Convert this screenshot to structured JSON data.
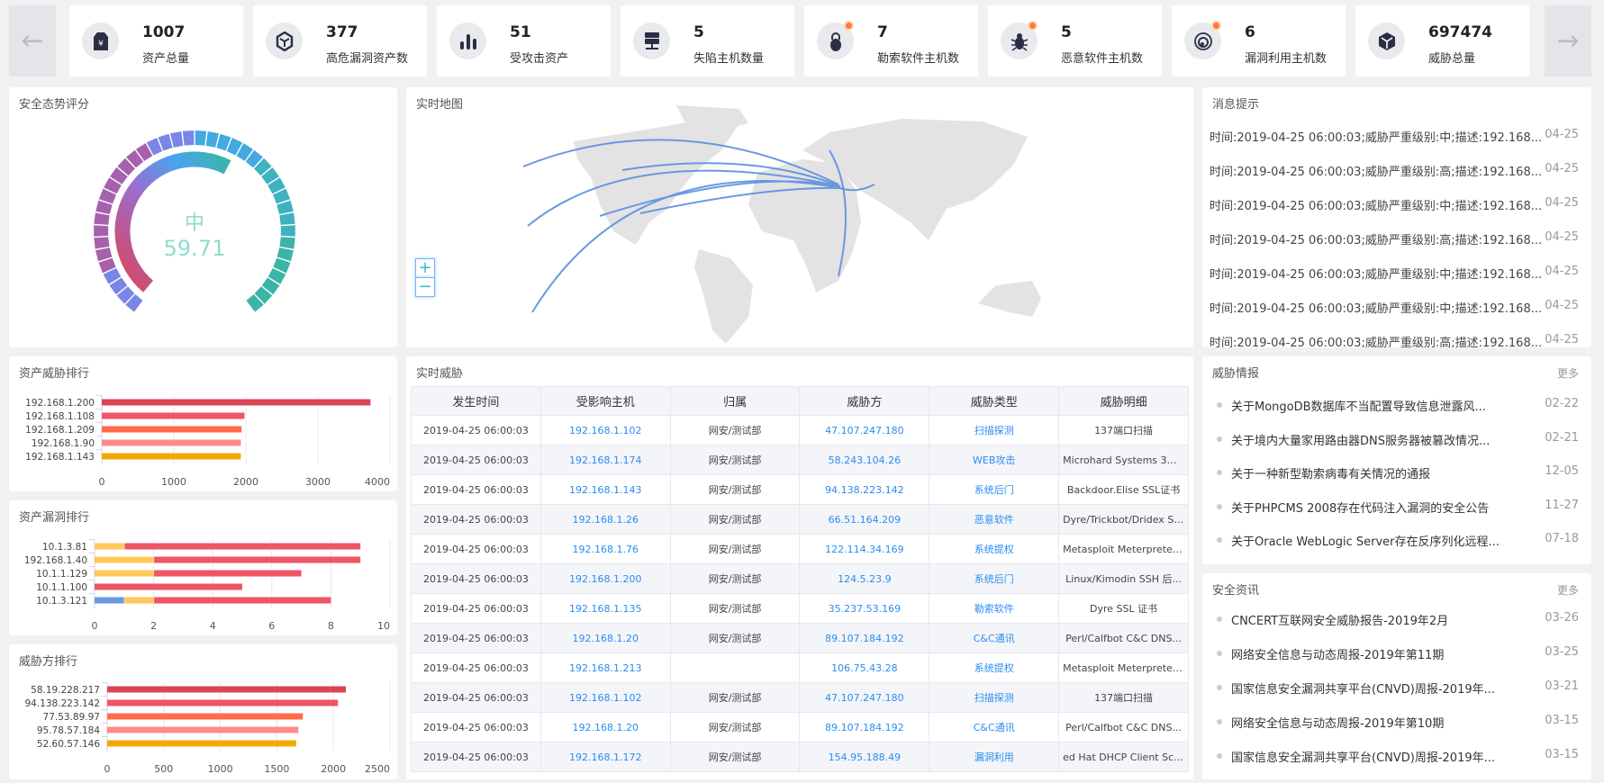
{
  "nav": {
    "prev_icon": "arrow-left-icon",
    "next_icon": "arrow-right-icon"
  },
  "stats": [
    {
      "value": "1007",
      "label": "资产总量",
      "icon": "money-tag-icon",
      "badge": false
    },
    {
      "value": "377",
      "label": "高危漏洞资产数",
      "icon": "shield-box-icon",
      "badge": false
    },
    {
      "value": "51",
      "label": "受攻击资产",
      "icon": "bar-chart-icon",
      "badge": false
    },
    {
      "value": "5",
      "label": "失陷主机数量",
      "icon": "server-icon",
      "badge": false
    },
    {
      "value": "7",
      "label": "勒索软件主机数",
      "icon": "lock-icon",
      "badge": true
    },
    {
      "value": "5",
      "label": "恶意软件主机数",
      "icon": "bug-icon",
      "badge": true
    },
    {
      "value": "6",
      "label": "漏洞利用主机数",
      "icon": "target-icon",
      "badge": true
    },
    {
      "value": "697474",
      "label": "威胁总量",
      "icon": "cube-icon",
      "badge": false
    }
  ],
  "gauge": {
    "title": "安全态势评分",
    "level": "中",
    "score": "59.71",
    "value": 59.71,
    "max": 100
  },
  "map": {
    "title": "实时地图",
    "zoom_in": "+",
    "zoom_out": "−"
  },
  "messages": {
    "title": "消息提示",
    "items": [
      {
        "text": "时间:2019-04-25 06:00:03;威胁严重级别:中;描述:192.168...",
        "date": "04-25"
      },
      {
        "text": "时间:2019-04-25 06:00:03;威胁严重级别:高;描述:192.168...",
        "date": "04-25"
      },
      {
        "text": "时间:2019-04-25 06:00:03;威胁严重级别:中;描述:192.168...",
        "date": "04-25"
      },
      {
        "text": "时间:2019-04-25 06:00:03;威胁严重级别:高;描述:192.168...",
        "date": "04-25"
      },
      {
        "text": "时间:2019-04-25 06:00:03;威胁严重级别:中;描述:192.168...",
        "date": "04-25"
      },
      {
        "text": "时间:2019-04-25 06:00:03;威胁严重级别:中;描述:192.168...",
        "date": "04-25"
      },
      {
        "text": "时间:2019-04-25 06:00:03;威胁严重级别:高;描述:192.168...",
        "date": "04-25"
      }
    ]
  },
  "threats": {
    "title": "实时威胁",
    "columns": [
      "发生时间",
      "受影响主机",
      "归属",
      "威胁方",
      "威胁类型",
      "威胁明细"
    ],
    "rows": [
      [
        "2019-04-25 06:00:03",
        "192.168.1.102",
        "网安/测试部",
        "47.107.247.180",
        "扫描探测",
        "137端口扫描"
      ],
      [
        "2019-04-25 06:00:03",
        "192.168.1.174",
        "网安/测试部",
        "58.243.104.26",
        "WEB攻击",
        "Microhard Systems 3G/..."
      ],
      [
        "2019-04-25 06:00:03",
        "192.168.1.143",
        "网安/测试部",
        "94.138.223.142",
        "系统后门",
        "Backdoor.Elise SSL证书"
      ],
      [
        "2019-04-25 06:00:03",
        "192.168.1.26",
        "网安/测试部",
        "66.51.164.209",
        "恶意软件",
        "Dyre/Trickbot/Dridex SS..."
      ],
      [
        "2019-04-25 06:00:03",
        "192.168.1.76",
        "网安/测试部",
        "122.114.34.169",
        "系统提权",
        "Metasploit Meterpreter ..."
      ],
      [
        "2019-04-25 06:00:03",
        "192.168.1.200",
        "网安/测试部",
        "124.5.23.9",
        "系统后门",
        "Linux/Kimodin SSH 后..."
      ],
      [
        "2019-04-25 06:00:03",
        "192.168.1.135",
        "网安/测试部",
        "35.237.53.169",
        "勒索软件",
        "Dyre SSL 证书"
      ],
      [
        "2019-04-25 06:00:03",
        "192.168.1.20",
        "网安/测试部",
        "89.107.184.192",
        "C&C通讯",
        "Perl/Calfbot C&C DNS..."
      ],
      [
        "2019-04-25 06:00:03",
        "192.168.1.213",
        "",
        "106.75.43.28",
        "系统提权",
        "Metasploit Meterpreter ..."
      ],
      [
        "2019-04-25 06:00:03",
        "192.168.1.102",
        "网安/测试部",
        "47.107.247.180",
        "扫描探测",
        "137端口扫描"
      ],
      [
        "2019-04-25 06:00:03",
        "192.168.1.20",
        "网安/测试部",
        "89.107.184.192",
        "C&C通讯",
        "Perl/Calfbot C&C DNS..."
      ],
      [
        "2019-04-25 06:00:03",
        "192.168.1.172",
        "网安/测试部",
        "154.95.188.49",
        "漏洞利用",
        "ed Hat DHCP Client Scri..."
      ]
    ]
  },
  "intel": {
    "title": "威胁情报",
    "more": "更多",
    "items": [
      {
        "text": "关于MongoDB数据库不当配置导致信息泄露风...",
        "date": "02-22"
      },
      {
        "text": "关于境内大量家用路由器DNS服务器被篡改情况...",
        "date": "02-21"
      },
      {
        "text": "关于一种新型勒索病毒有关情况的通报",
        "date": "12-05"
      },
      {
        "text": "关于PHPCMS 2008存在代码注入漏洞的安全公告",
        "date": "11-27"
      },
      {
        "text": "关于Oracle WebLogic Server存在反序列化远程...",
        "date": "07-18"
      }
    ]
  },
  "news": {
    "title": "安全资讯",
    "more": "更多",
    "items": [
      {
        "text": "CNCERT互联网安全威胁报告-2019年2月",
        "date": "03-26"
      },
      {
        "text": "网络安全信息与动态周报-2019年第11期",
        "date": "03-25"
      },
      {
        "text": "国家信息安全漏洞共享平台(CNVD)周报-2019年...",
        "date": "03-21"
      },
      {
        "text": "网络安全信息与动态周报-2019年第10期",
        "date": "03-15"
      },
      {
        "text": "国家信息安全漏洞共享平台(CNVD)周报-2019年...",
        "date": "03-15"
      }
    ]
  },
  "chart_data": [
    {
      "type": "bar",
      "title": "资产威胁排行",
      "categories": [
        "192.168.1.200",
        "192.168.1.108",
        "192.168.1.209",
        "192.168.1.90",
        "192.168.1.143"
      ],
      "series": [
        {
          "name": "威胁",
          "values": [
            3730,
            1980,
            1940,
            1930,
            1930
          ]
        }
      ],
      "colors": [
        "#dc4454",
        "#ee5566",
        "#ff6b4a",
        "#ff8a8a",
        "#f4a900"
      ],
      "xlim": [
        0,
        4000
      ],
      "ticks": [
        0,
        1000,
        2000,
        3000,
        4000
      ]
    },
    {
      "type": "bar",
      "title": "资产漏洞排行",
      "stacked": true,
      "categories": [
        "10.1.3.81",
        "192.168.1.40",
        "10.1.1.129",
        "10.1.1.100",
        "10.1.3.121"
      ],
      "series": [
        {
          "name": "低",
          "color": "#6a9be0",
          "values": [
            0,
            0,
            0,
            0,
            1
          ]
        },
        {
          "name": "中",
          "color": "#fdc95a",
          "values": [
            1,
            2,
            2,
            0,
            1
          ]
        },
        {
          "name": "高",
          "color": "#ee5566",
          "values": [
            8,
            7,
            5,
            5,
            6
          ]
        }
      ],
      "xlim": [
        0,
        10
      ],
      "ticks": [
        0,
        2,
        4,
        6,
        8,
        10
      ]
    },
    {
      "type": "bar",
      "title": "威胁方排行",
      "categories": [
        "58.19.228.217",
        "94.138.223.142",
        "77.53.89.97",
        "95.78.57.184",
        "52.60.57.146"
      ],
      "series": [
        {
          "name": "威胁",
          "values": [
            2110,
            2040,
            1730,
            1690,
            1670
          ]
        }
      ],
      "colors": [
        "#dc4454",
        "#ee5566",
        "#ff6b4a",
        "#ff8a8a",
        "#f4a900"
      ],
      "xlim": [
        0,
        2500
      ],
      "ticks": [
        0,
        500,
        1000,
        1500,
        2000,
        2500
      ]
    }
  ]
}
